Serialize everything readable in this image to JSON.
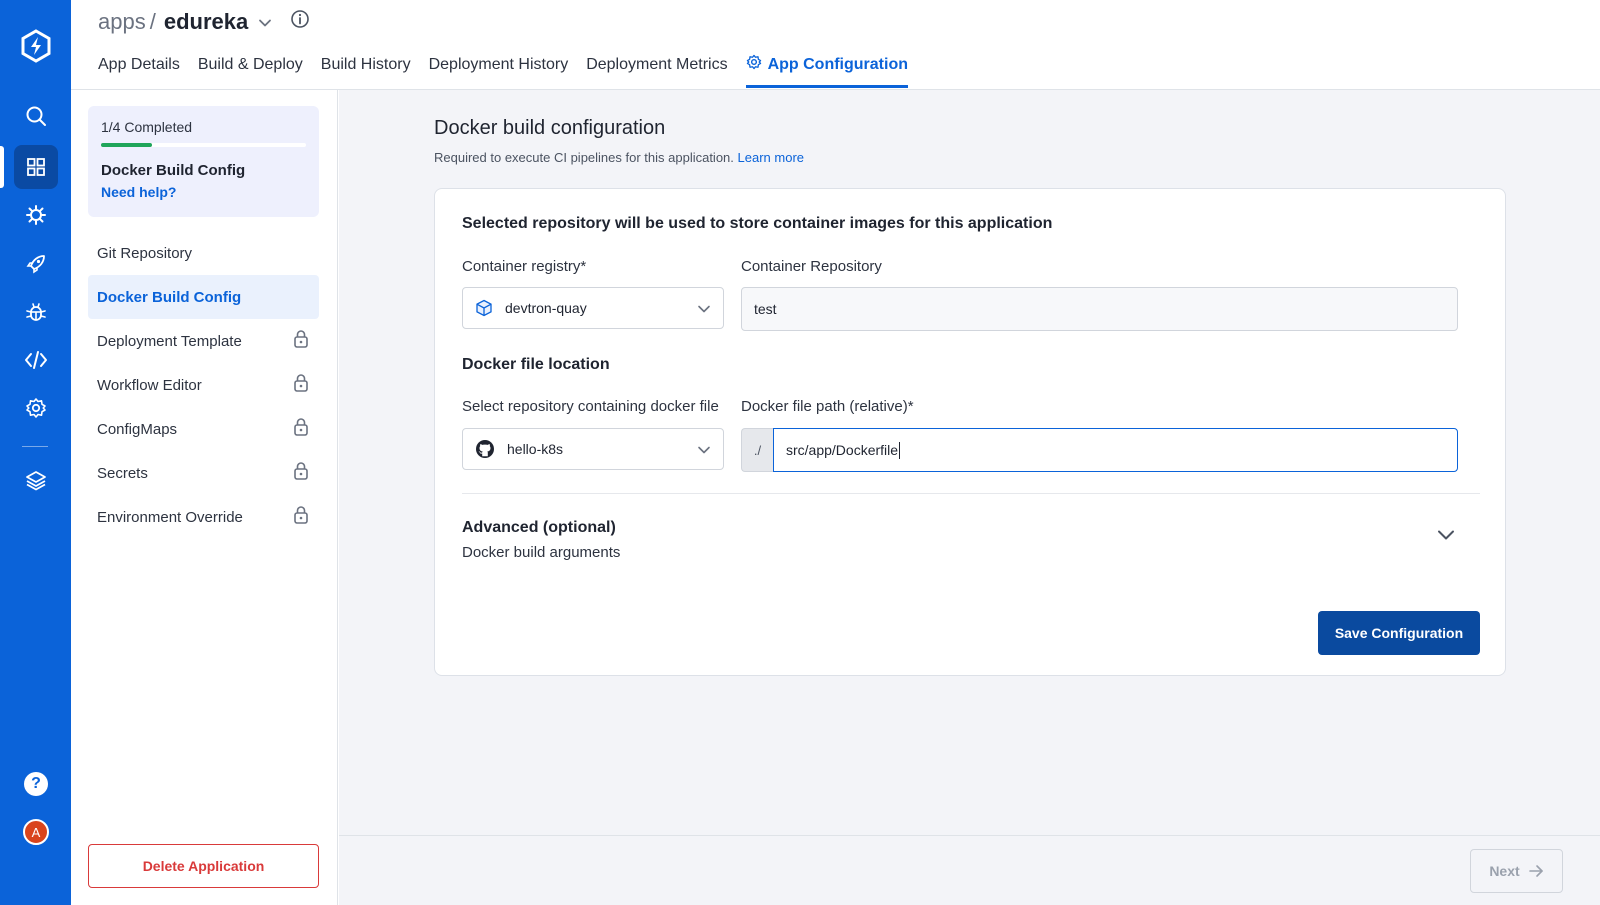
{
  "colors": {
    "rail": "#0b63d9",
    "primary": "#0b63d9",
    "save_button": "#0a4a9f",
    "danger": "#d93a3a",
    "progress": "#1fa55a"
  },
  "rail": {
    "icons": [
      "devtron-logo-icon",
      "search-icon",
      "apps-grid-icon",
      "chart-store-icon",
      "deploy-rocket-icon",
      "security-bug-icon",
      "code-icon",
      "settings-gear-icon",
      "stack-layers-icon"
    ],
    "help": "?",
    "avatar_letter": "A"
  },
  "header": {
    "breadcrumb_root": "apps",
    "breadcrumb_sep": "/",
    "app_name": "edureka",
    "tabs": [
      {
        "label": "App Details"
      },
      {
        "label": "Build & Deploy"
      },
      {
        "label": "Build History"
      },
      {
        "label": "Deployment History"
      },
      {
        "label": "Deployment Metrics"
      },
      {
        "label": "App Configuration",
        "active": true
      }
    ]
  },
  "config_sidebar": {
    "progress_text": "1/4 Completed",
    "progress_fraction": 0.25,
    "current_step": "Docker Build Config",
    "help_link": "Need help?",
    "items": [
      {
        "label": "Git Repository",
        "locked": false
      },
      {
        "label": "Docker Build Config",
        "locked": false,
        "active": true
      },
      {
        "label": "Deployment Template",
        "locked": true
      },
      {
        "label": "Workflow Editor",
        "locked": true
      },
      {
        "label": "ConfigMaps",
        "locked": true
      },
      {
        "label": "Secrets",
        "locked": true
      },
      {
        "label": "Environment Override",
        "locked": true
      }
    ],
    "delete_label": "Delete Application"
  },
  "main": {
    "title": "Docker build configuration",
    "subtitle": "Required to execute CI pipelines for this application.",
    "learn_more": "Learn more",
    "card_title": "Selected repository will be used to store container images for this application",
    "registry_label": "Container registry*",
    "registry_value": "devtron-quay",
    "repository_label": "Container Repository",
    "repository_value": "test",
    "dockerfile_section": "Docker file location",
    "repo_select_label": "Select repository containing docker file",
    "repo_select_value": "hello-k8s",
    "path_label": "Docker file path (relative)*",
    "path_prefix": "./",
    "path_value": "src/app/Dockerfile",
    "advanced_title": "Advanced (optional)",
    "advanced_sub": "Docker build arguments",
    "save_label": "Save Configuration",
    "next_label": "Next"
  }
}
